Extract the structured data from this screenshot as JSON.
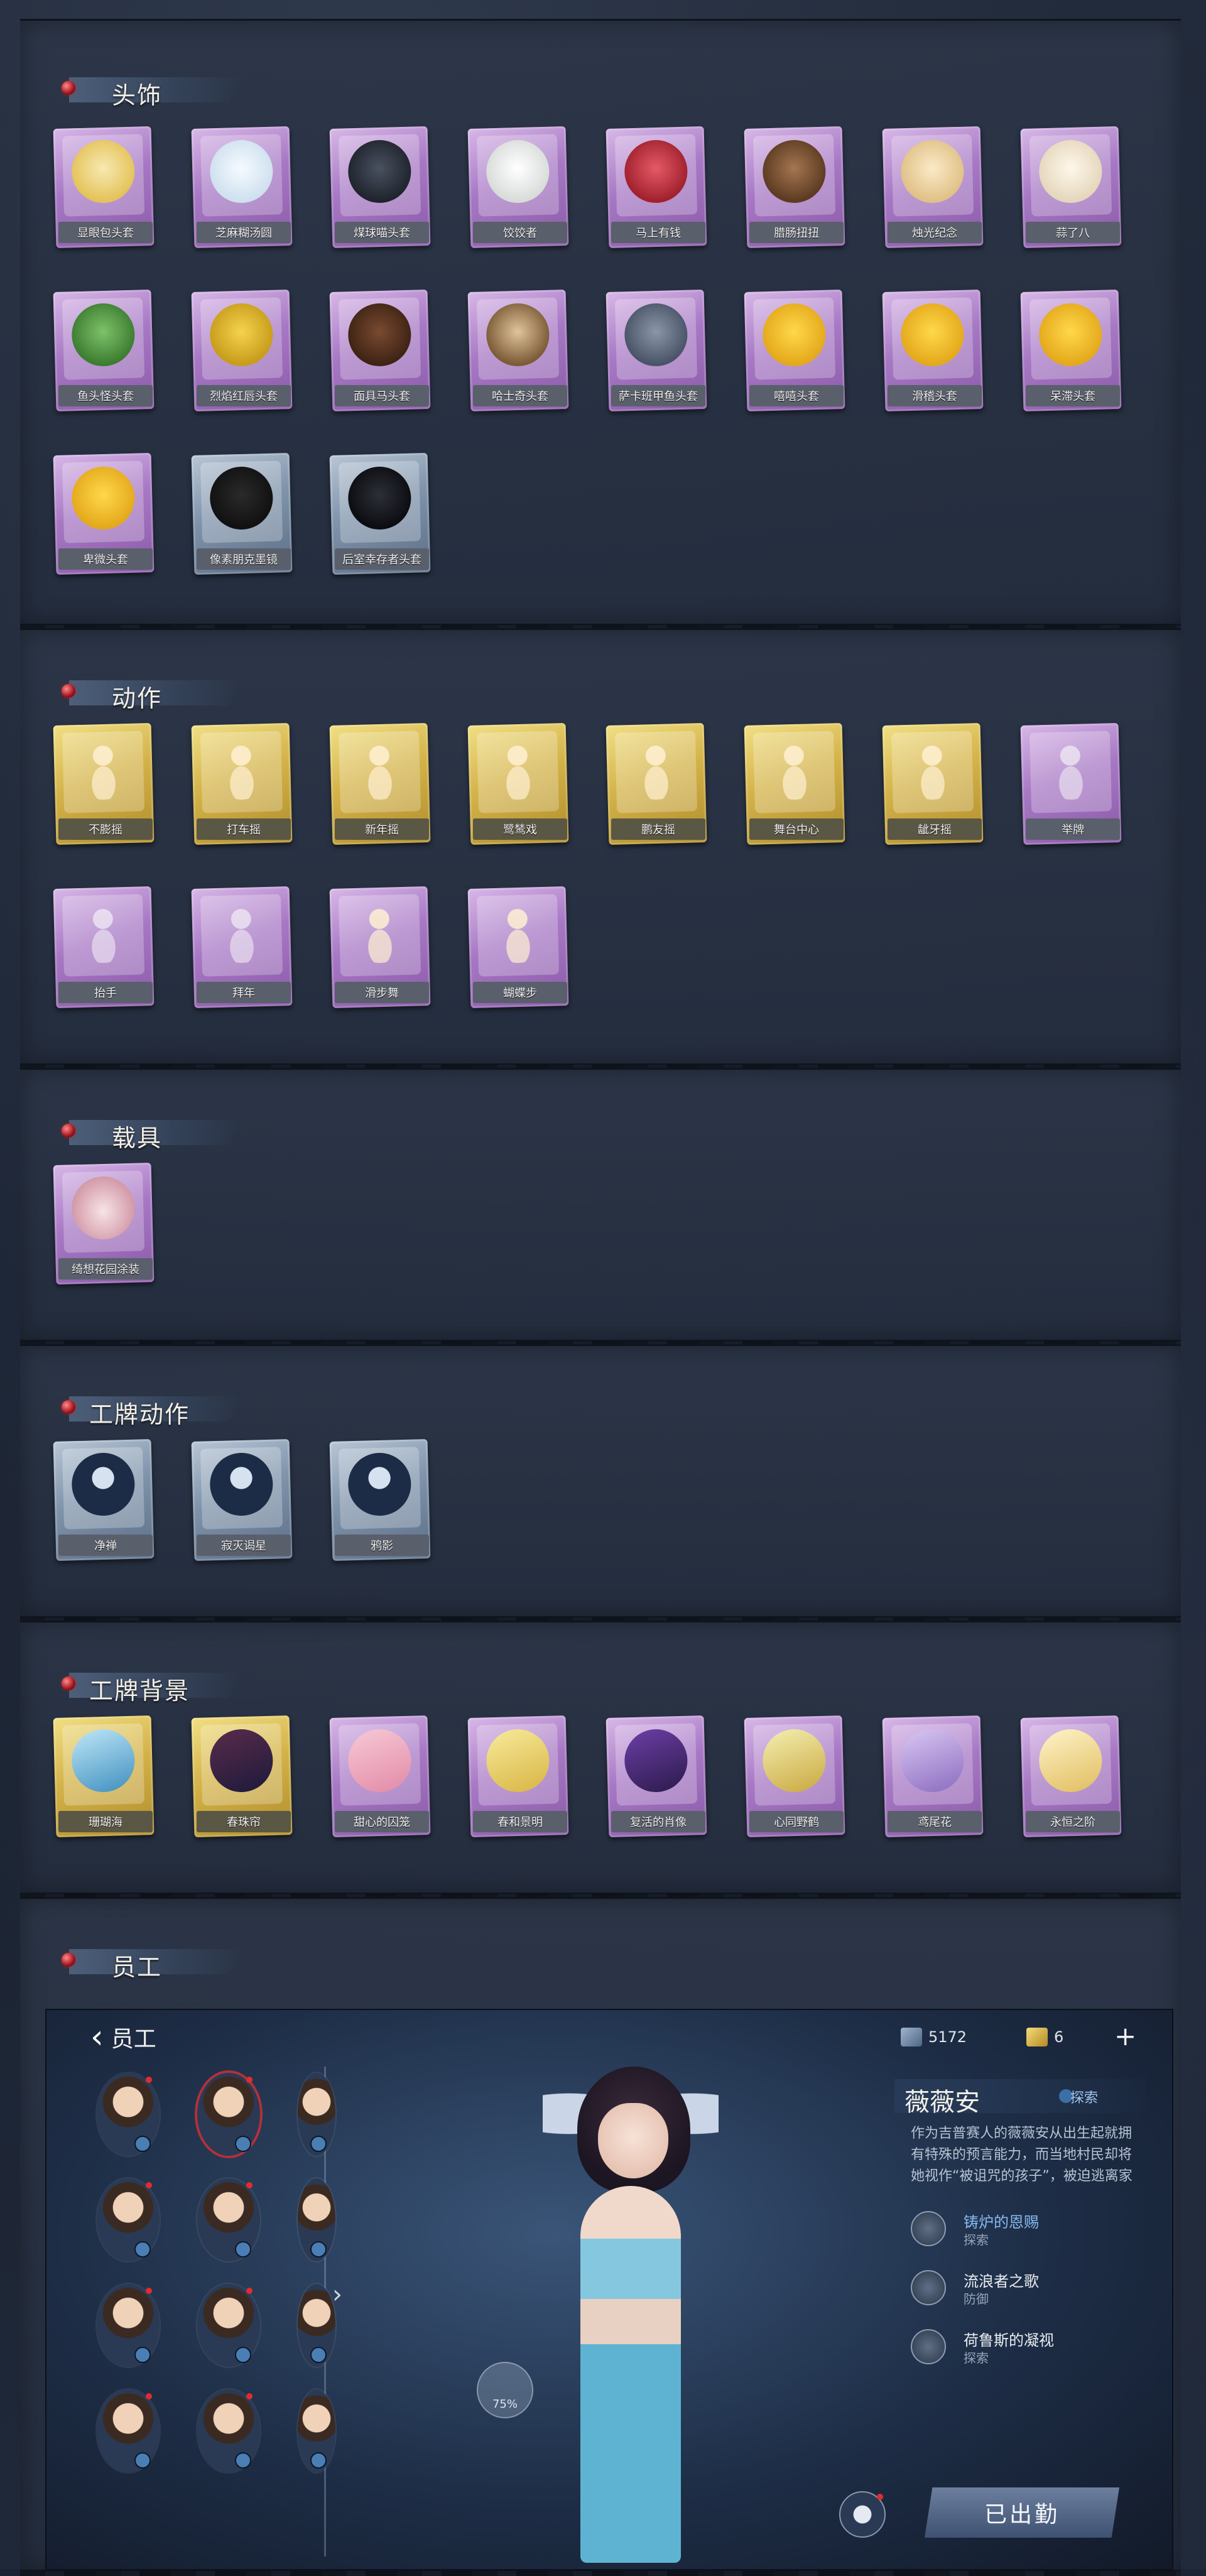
{
  "sections": {
    "headwear": {
      "title": "头饰",
      "items": [
        "显眼包头套",
        "芝麻糊汤圆",
        "煤球喵头套",
        "饺饺者",
        "马上有钱",
        "腊肠扭扭",
        "烛光纪念",
        "蒜了八",
        "鱼头怪头套",
        "烈焰红唇头套",
        "面具马头套",
        "哈士奇头套",
        "萨卡班甲鱼头套",
        "嘻嘻头套",
        "滑稽头套",
        "呆滞头套",
        "卑微头套",
        "像素朋克墨镜",
        "后室幸存者头套"
      ]
    },
    "actions": {
      "title": "动作",
      "items": [
        "不膨摇",
        "打车摇",
        "新年摇",
        "鹭鸶戏",
        "鹏友摇",
        "舞台中心",
        "龇牙摇",
        "举牌",
        "抬手",
        "拜年",
        "滑步舞",
        "蝴蝶步"
      ]
    },
    "vehicles": {
      "title": "载具",
      "items": [
        "绮想花园涂装"
      ]
    },
    "badge_actions": {
      "title": "工牌动作",
      "items": [
        "净禅",
        "寂灭谒星",
        "鸦影"
      ]
    },
    "badge_backgrounds": {
      "title": "工牌背景",
      "items": [
        "珊瑚海",
        "春珠帘",
        "甜心的囚笼",
        "春和景明",
        "复活的肖像",
        "心同野鹤",
        "鸢尾花",
        "永恒之阶"
      ]
    },
    "staff": {
      "title": "员工"
    }
  },
  "staff_ui": {
    "back_label": "员工",
    "currency": [
      {
        "icon": "feather-ticket-icon",
        "value": "5172"
      },
      {
        "icon": "gold-ingot-icon",
        "value": "6"
      }
    ],
    "add_label": "+",
    "character_name": "薇薇安",
    "character_tag": "探索",
    "character_desc": "作为吉普赛人的薇薇安从出生起就拥有特殊的预言能力，而当地村民却将她视作“被诅咒的孩子”，被迫逃离家乡的薇薇安开始",
    "traits": [
      {
        "name": "铸炉的恩赐",
        "type": "探索",
        "highlight": true
      },
      {
        "name": "流浪者之歌",
        "type": "防御",
        "highlight": false
      },
      {
        "name": "荷鲁斯的凝视",
        "type": "探索",
        "highlight": false
      }
    ],
    "pose_badge": "75%",
    "deploy_label": "已出勤"
  },
  "colors": {
    "purple_card": "#a778c4",
    "gold_card": "#d4b34a",
    "blue_card": "#7f93aa",
    "header_gem": "#a3121b"
  }
}
